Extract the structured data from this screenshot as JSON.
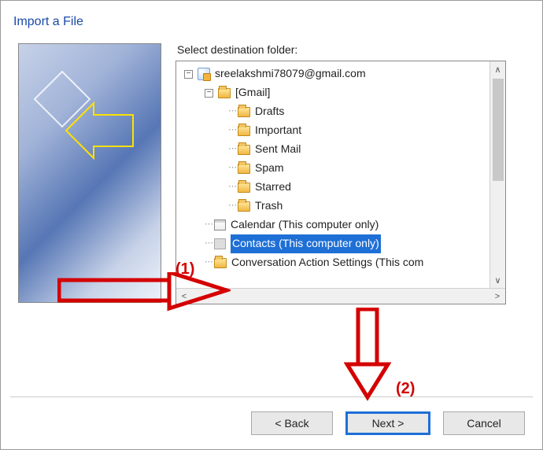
{
  "title": "Import a File",
  "label": "Select destination folder:",
  "tree": {
    "root": "sreelakshmi78079@gmail.com",
    "gmail": "[Gmail]",
    "folders": {
      "drafts": "Drafts",
      "important": "Important",
      "sentmail": "Sent Mail",
      "spam": "Spam",
      "starred": "Starred",
      "trash": "Trash"
    },
    "calendar": "Calendar (This computer only)",
    "contacts": "Contacts (This computer only)",
    "conv": "Conversation Action Settings (This com"
  },
  "buttons": {
    "back": "<  Back",
    "next": "Next  >",
    "cancel": "Cancel"
  },
  "annotations": {
    "one": "(1)",
    "two": "(2)"
  }
}
